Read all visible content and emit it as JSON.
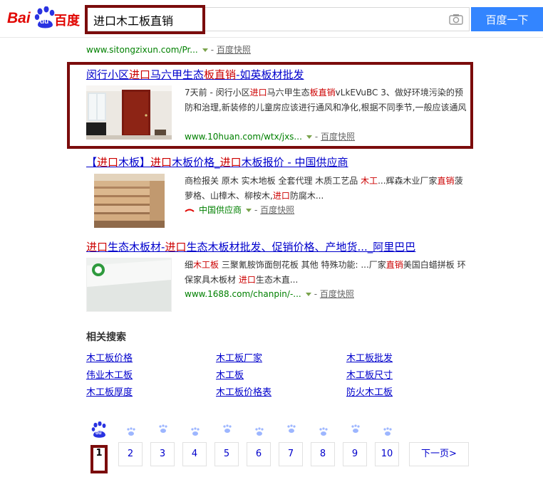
{
  "header": {
    "logo_bai": "Bai",
    "logo_du": "du",
    "logo_cn": "百度",
    "search_value": "进口木工板直销",
    "search_button": "百度一下"
  },
  "colors": {
    "brand_red": "#e10602",
    "brand_blue": "#2932e1",
    "button_blue": "#3385ff",
    "highlight": "#7b0c0c"
  },
  "result1": {
    "url": "www.sitongzixun.com/Pr...",
    "cache": "百度快照"
  },
  "result2": {
    "title": [
      "闵行小区",
      "进口",
      "马六甲生态",
      "板直销",
      "-如英板材批发"
    ],
    "desc_parts": [
      "7天前 - 闵行小区",
      "进口",
      "马六甲生态",
      "板直销",
      "vLkEVuBC 3、做好环境污染的预防和治理,新装修的儿童房应该进行通风和净化,根据不同季节,一般应该通风"
    ],
    "url": "www.10huan.com/wtx/jxs...",
    "cache": "百度快照"
  },
  "result3": {
    "title": [
      "【",
      "进口",
      "木板】",
      "进口",
      "木板价格_",
      "进口",
      "木板报价 - 中国供应商"
    ],
    "desc_parts": [
      "商检报关 原木 实木地板 全套代理 木质工艺品 ",
      "木工",
      "...辉森木业厂家",
      "直销",
      "菠萝格、山樟木、柳桉木,",
      "进口",
      "防腐木..."
    ],
    "source": "中国供应商",
    "cache": "百度快照"
  },
  "result4": {
    "title": [
      "进口",
      "生态木板材-",
      "进口",
      "生态木板材批发、促销价格、产地货..._阿里巴巴"
    ],
    "desc_parts": [
      "细",
      "木工板",
      " 三聚氰胺饰面刨花板 其他 特殊功能: ...厂家",
      "直销",
      "美国白蜡拼板 环保家具木板材 ",
      "进口",
      "生态木直..."
    ],
    "url": "www.1688.com/chanpin/-...",
    "cache": "百度快照"
  },
  "related": {
    "title": "相关搜索",
    "links": [
      "木工板价格",
      "木工板厂家",
      "木工板批发",
      "伟业木工板",
      "木工板",
      "木工板尺寸",
      "木工板厚度",
      "木工板价格表",
      "防火木工板"
    ]
  },
  "pagination": {
    "pages": [
      "1",
      "2",
      "3",
      "4",
      "5",
      "6",
      "7",
      "8",
      "9",
      "10"
    ],
    "current": "1",
    "next": "下一页>",
    "paw_du": "du"
  }
}
